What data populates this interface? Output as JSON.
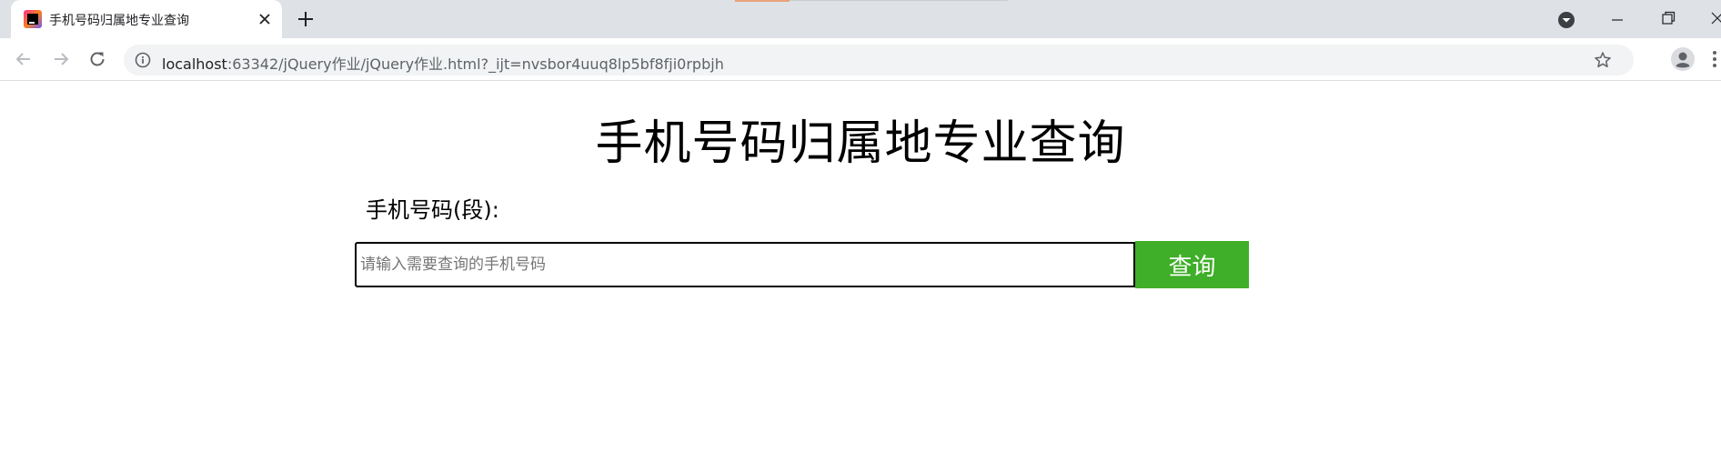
{
  "browser": {
    "tab": {
      "title": "手机号码归属地专业查询"
    },
    "address_bar": {
      "host": "localhost",
      "path": ":63342/jQuery作业/jQuery作业.html?_ijt=nvsbor4uuq8lp5bf8fji0rpbjh"
    },
    "icons": {
      "favicon": "webstorm-favicon",
      "close": "close-icon",
      "new_tab": "plus-icon",
      "tab_search": "chevron-down-circle-icon",
      "back": "arrow-left-icon",
      "forward": "arrow-right-icon",
      "reload": "reload-icon",
      "site_info": "info-icon",
      "bookmark": "star-icon",
      "profile": "profile-icon",
      "menu": "kebab-menu-icon"
    }
  },
  "page": {
    "title": "手机号码归属地专业查询",
    "field_label": "手机号码(段):",
    "input": {
      "value": "",
      "placeholder": "请输入需要查询的手机号码"
    },
    "button_label": "查询",
    "colors": {
      "button_bg": "#3fae29",
      "button_text": "#ffffff"
    }
  }
}
